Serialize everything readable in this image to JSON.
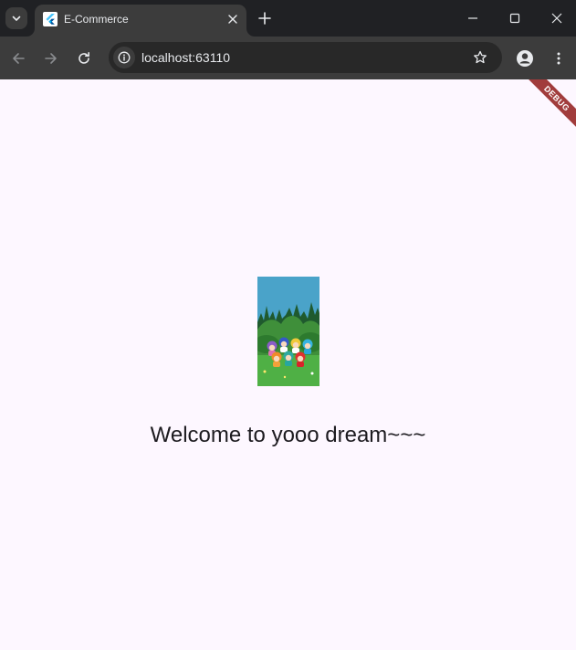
{
  "browser": {
    "tab": {
      "title": "E-Commerce"
    },
    "address_bar": {
      "url": "localhost:63110"
    }
  },
  "page": {
    "welcome_text": "Welcome to yooo dream~~~",
    "debug_label": "DEBUG"
  },
  "colors": {
    "page_background": "#fdf7ff",
    "browser_frame": "#202124",
    "toolbar": "#3c3c3c",
    "debug_ribbon": "#a13c3c"
  }
}
